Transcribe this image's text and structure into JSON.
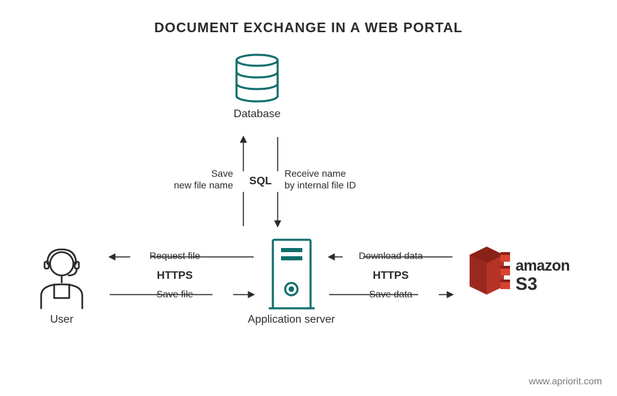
{
  "title": "DOCUMENT EXCHANGE IN A WEB PORTAL",
  "nodes": {
    "database": "Database",
    "user": "User",
    "appserver": "Application server",
    "s3_line1": "amazon",
    "s3_line2": "S3"
  },
  "edges": {
    "request_file": "Request file",
    "save_file": "Save file",
    "download_data": "Download data",
    "save_data": "Save data",
    "save_new_file_name_l1": "Save",
    "save_new_file_name_l2": "new file name",
    "receive_name_l1": "Receive name",
    "receive_name_l2": "by internal file ID"
  },
  "protocols": {
    "https_left": "HTTPS",
    "https_right": "HTTPS",
    "sql": "SQL"
  },
  "footer": "www.apriorit.com",
  "colors": {
    "teal": "#0f6e6b",
    "dark": "#2b2b2b",
    "s3red": "#b53326"
  }
}
